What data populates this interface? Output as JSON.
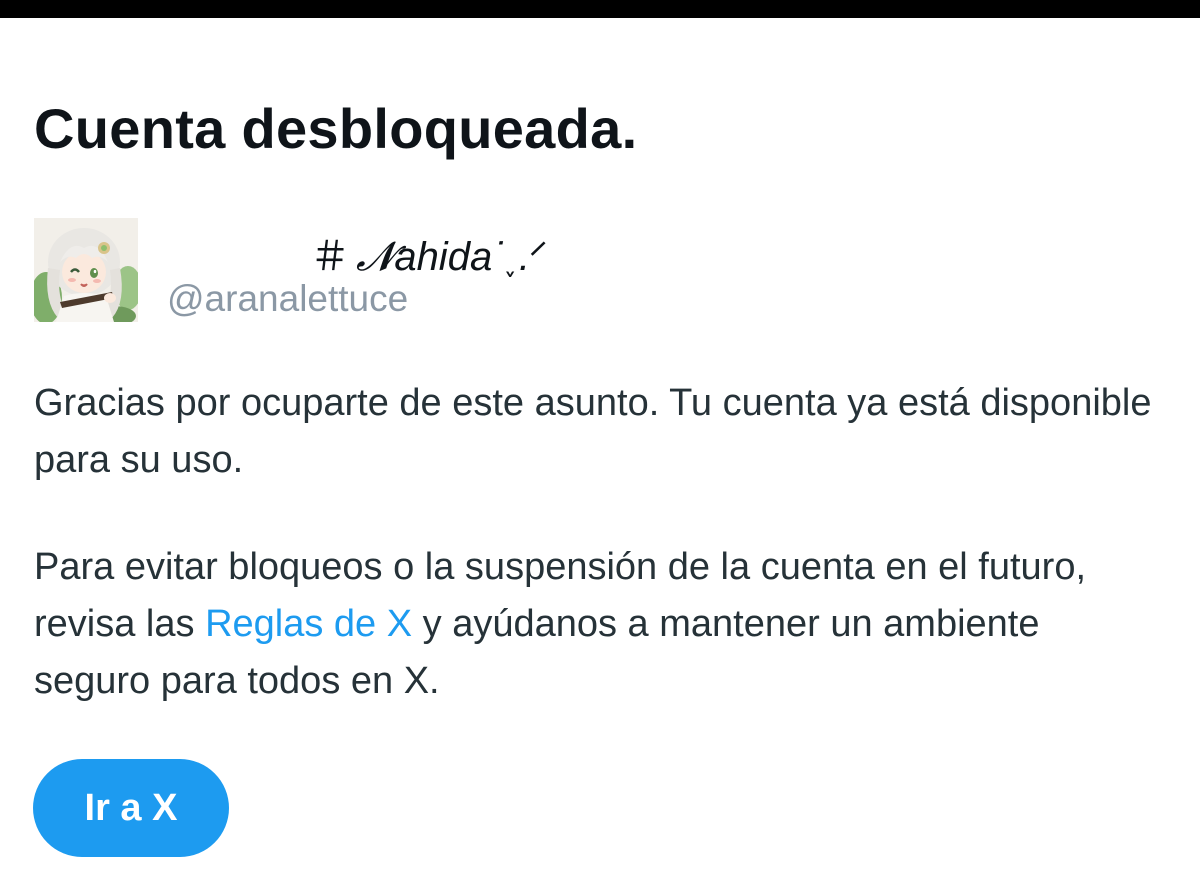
{
  "header": {
    "title": "Cuenta desbloqueada."
  },
  "profile": {
    "display_name_prefix": "＃",
    "display_name": "𝓝ahida˙˯.ᐟ",
    "handle": "@aranalettuce",
    "avatar_icon": "anime-character-avatar"
  },
  "body": {
    "paragraph1": "Gracias por ocuparte de este asunto. Tu cuenta ya está disponible para su uso.",
    "paragraph2_before": "Para evitar bloqueos o la suspensión de la cuenta en el futuro, revisa las ",
    "paragraph2_link": "Reglas de X",
    "paragraph2_after": " y ayúdanos a mantener un ambiente seguro para todos en X."
  },
  "actions": {
    "primary_button_label": "Ir a X"
  },
  "colors": {
    "accent": "#1d9bf0",
    "title_text": "#0f1419",
    "body_text": "#263238",
    "muted_text": "#8b98a5",
    "top_bar": "#000000"
  }
}
